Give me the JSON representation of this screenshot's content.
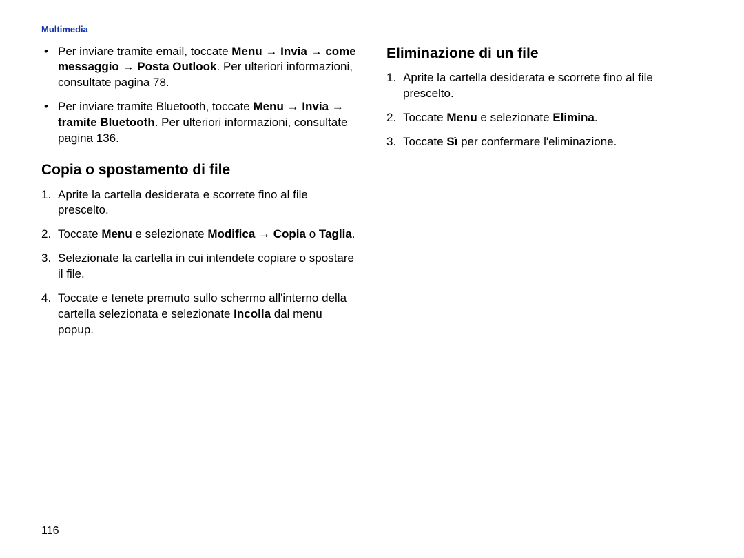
{
  "header": "Multimedia",
  "pageNumber": "116",
  "left": {
    "bullets": [
      {
        "pre": "Per inviare tramite email, toccate ",
        "bold1": "Menu",
        "arrow1": " → ",
        "bold2": "Invia",
        "arrow2": " → ",
        "bold3": "come messaggio",
        "arrow3": " → ",
        "bold4": "Posta Outlook",
        "post": ". Per ulteriori informazioni, consultate pagina 78."
      },
      {
        "pre": "Per inviare tramite Bluetooth, toccate ",
        "bold1": "Menu",
        "arrow1": " → ",
        "bold2": "Invia",
        "arrow2": " → ",
        "bold3": "tramite Bluetooth",
        "post": ". Per ulteriori informazioni, consultate pagina 136."
      }
    ],
    "heading": "Copia o spostamento di file",
    "steps": [
      {
        "n": "1.",
        "text": "Aprite la cartella desiderata e scorrete fino al file prescelto."
      },
      {
        "n": "2.",
        "pre": "Toccate ",
        "b1": "Menu",
        "mid1": " e selezionate ",
        "b2": "Modifica",
        "arrow": " → ",
        "b3": "Copia",
        "mid2": " o ",
        "b4": "Taglia",
        "post": "."
      },
      {
        "n": "3.",
        "text": "Selezionate la cartella in cui intendete copiare o spostare il file."
      },
      {
        "n": "4.",
        "pre": "Toccate e tenete premuto sullo schermo all'interno della cartella selezionata e selezionate ",
        "b1": "Incolla",
        "post": " dal menu popup."
      }
    ]
  },
  "right": {
    "heading": "Eliminazione di un file",
    "steps": [
      {
        "n": "1.",
        "text": "Aprite la cartella desiderata e scorrete fino al file prescelto."
      },
      {
        "n": "2.",
        "pre": "Toccate ",
        "b1": "Menu",
        "mid1": " e selezionate ",
        "b2": "Elimina",
        "post": "."
      },
      {
        "n": "3.",
        "pre": "Toccate ",
        "b1": "Sì",
        "post": " per confermare l'eliminazione."
      }
    ]
  }
}
